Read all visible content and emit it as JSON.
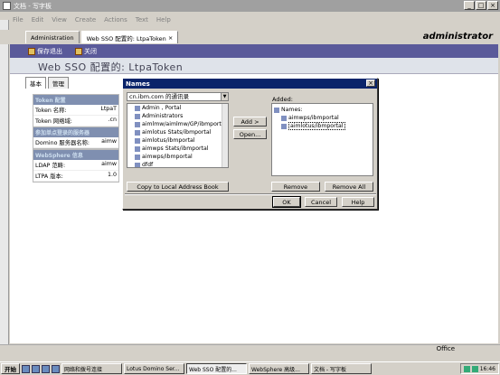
{
  "window": {
    "title": "文档 - 写字板"
  },
  "menubar": [
    "File",
    "Edit",
    "View",
    "Create",
    "Actions",
    "Text",
    "Help"
  ],
  "tabs": [
    {
      "label": "Administration"
    },
    {
      "label": "Web SSO 配置的: LtpaToken"
    }
  ],
  "header": {
    "user": "administrator"
  },
  "actions": [
    {
      "label": "保存退出"
    },
    {
      "label": "关闭"
    }
  ],
  "page": {
    "title": "Web SSO 配置的: LtpaToken"
  },
  "content_tabs": [
    {
      "label": "基本"
    },
    {
      "label": "管理"
    }
  ],
  "panels": {
    "token": {
      "heading": "Token 配置",
      "rows": [
        {
          "label": "Token 名称:",
          "value": "LtpaT"
        },
        {
          "label": "Token 网络域:",
          "value": ".cn"
        }
      ]
    },
    "servers": {
      "heading": "参加单点登录的服务器",
      "rows": [
        {
          "label": "Domino 服务器名称:",
          "value": "aimw"
        }
      ]
    },
    "websphere": {
      "heading": "WebSphere 信息",
      "rows": [
        {
          "label": "LDAP 范畴:",
          "value": "aimw"
        },
        {
          "label": "LTPA 版本:",
          "value": "1.0"
        }
      ]
    }
  },
  "dialog": {
    "title": "Names",
    "directory": "cn.ibm.com 的通讯录",
    "names": [
      "Admin , Portal",
      "Administrators",
      "aimlmw/aimlmw/GP/ibmportal",
      "aimlotus Stats/ibmportal",
      "aimlotus/ibmportal",
      "aimwps Stats/ibmportal",
      "aimwps/ibmportal",
      "dfdf"
    ],
    "add_label": "Add >",
    "open_label": "Open...",
    "copy_label": "Copy to Local Address Book",
    "added_label": "Added:",
    "added_root": "Names:",
    "added": [
      "aimwps/ibmportal",
      "aimlotus/ibmportal"
    ],
    "remove_label": "Remove",
    "remove_all_label": "Remove All",
    "ok_label": "OK",
    "cancel_label": "Cancel",
    "help_label": "Help"
  },
  "statusbar": {
    "office": "Office"
  },
  "taskbar": {
    "start": "开始",
    "tasks": [
      {
        "label": "网络和拨号连接"
      },
      {
        "label": "Lotus Domino Ser..."
      },
      {
        "label": "Web SSO 配置的..."
      },
      {
        "label": "WebSphere 高级..."
      },
      {
        "label": "文档 - 写字板"
      }
    ],
    "clock": "16:46"
  }
}
